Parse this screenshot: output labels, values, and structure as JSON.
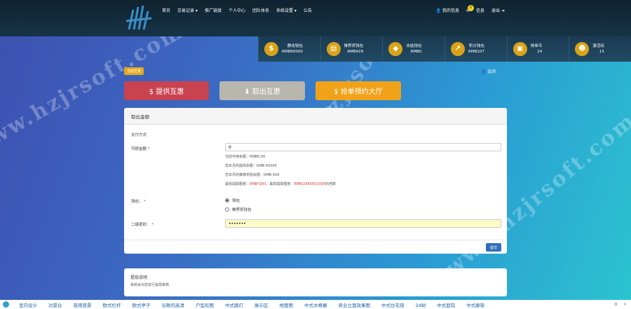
{
  "nav": {
    "items": [
      "首页",
      "交易记录 ▾",
      "推广链接",
      "个人中心",
      "团队体系",
      "系统设置 ▾",
      "公告"
    ],
    "right": {
      "profile": "我的信息",
      "messages": "信息",
      "messages_count": "0",
      "logout": "退出"
    }
  },
  "stats": [
    {
      "icon": "$",
      "label": "静态钱包",
      "value": "RMB60000"
    },
    {
      "icon": "▤",
      "label": "推荐奖钱包",
      "value": "RMB429"
    },
    {
      "icon": "◆",
      "label": "冻结钱包",
      "value": "RMB0"
    },
    {
      "icon": "↗",
      "label": "积分钱包",
      "value": "RMB107"
    },
    {
      "icon": "▣",
      "label": "排单币",
      "value": "24"
    },
    {
      "icon": "☻",
      "label": "激活码",
      "value": "15"
    }
  ],
  "breadcrumb": "当前位置",
  "user_mini": "会员",
  "buttons": {
    "provide": "$ 提供互惠",
    "withdraw": "⬇ 取出互惠",
    "order": "$ 抢单预约大厅"
  },
  "panel": {
    "title": "取出金额",
    "section": "支付方式",
    "amount_label": "可提金额",
    "amount_value": "0",
    "hints": [
      "当前可用余额：RMB0.00",
      "您本月的提现余额：RMB 60000",
      "您本月的推荐奖励余额：RMB 429"
    ],
    "hint4_prefix": "最低提取额度：",
    "hint4_red1": "RMB*200",
    "hint4_mid": "，最高提取额度：",
    "hint4_red2": "RMB100000/1000",
    "hint4_suffix": "的倍数",
    "wallet_label": "钱包：",
    "radio1": "钱包",
    "radio2": "推荐奖钱包",
    "password_label": "二级密码：",
    "password_value": "•••••••",
    "submit": "提交"
  },
  "panel2": {
    "title": "提现说明",
    "text": "系统会对您进行提现审核"
  },
  "bottom_links": [
    "室内设计",
    "对景台",
    "夜观夜景",
    "欧式栏杆",
    "欧式亭子",
    "谷歌的高清",
    "户型彩图",
    "中式路灯",
    "展示区",
    "地面图",
    "中式木格栅",
    "商业立面效果图",
    "中式住宅部",
    "2d树",
    "中式庭院",
    "中式廊架"
  ],
  "watermarks": [
    "www.hzjrsoft.com",
    "www.hzjrsoft.com",
    "www.hzjrsoft.com",
    "www.hzjrsoft.com"
  ]
}
